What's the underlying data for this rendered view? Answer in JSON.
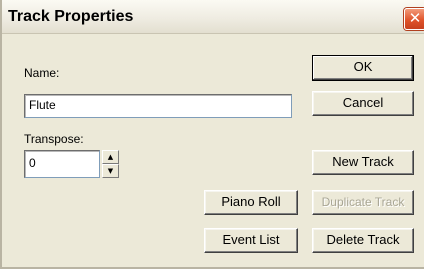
{
  "window": {
    "title": "Track Properties",
    "close_glyph": "✕"
  },
  "fields": {
    "name_label": "Name:",
    "name_value": "Flute",
    "transpose_label": "Transpose:",
    "transpose_value": "0"
  },
  "buttons": {
    "ok": "OK",
    "cancel": "Cancel",
    "new_track": "New Track",
    "piano_roll": "Piano Roll",
    "duplicate_track": "Duplicate Track",
    "event_list": "Event List",
    "delete_track": "Delete Track"
  },
  "icons": {
    "spin_up": "▲",
    "spin_down": "▼"
  },
  "colors": {
    "dialog_bg": "#ece9d8",
    "close_button": "#e0542b",
    "disabled_text": "#a9a695"
  }
}
